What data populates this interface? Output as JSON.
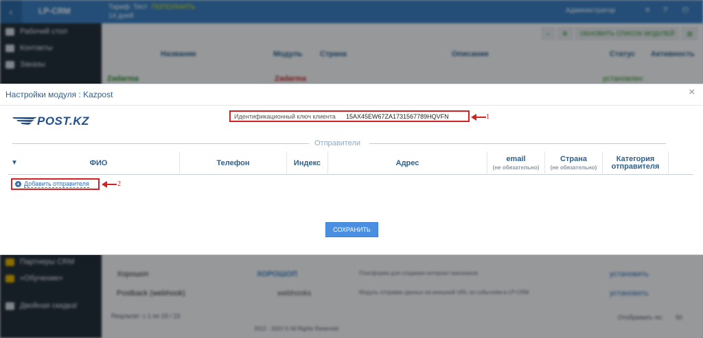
{
  "topbar": {
    "back_icon": "chevron-left",
    "logo": "LP-CRM",
    "tariff_line1": "Тариф: Тест",
    "tariff_badge": "ПОПОЛНИТЬ",
    "tariff_line2": "14 дней",
    "user": "Администратор"
  },
  "sidebar": {
    "items": [
      {
        "label": "Рабочий стол",
        "icon": "monitor-icon"
      },
      {
        "label": "Контакты",
        "icon": "users-icon"
      },
      {
        "label": "Заказы",
        "icon": "cart-icon"
      },
      {
        "label": "Партнеры CRM",
        "icon": "handshake-icon"
      },
      {
        "label": "«Обучение»",
        "icon": "video-icon"
      },
      {
        "label": "Двойная скидка!",
        "icon": "star-icon"
      }
    ]
  },
  "content": {
    "update_btn": "ОБНОВИТЬ СПИСОК МОДУЛЕЙ",
    "columns": [
      "Название",
      "Модуль",
      "Страна",
      "Описание",
      "Статус",
      "Активность"
    ],
    "status_filter": "Все",
    "rows": [
      {
        "name": "Zadarma",
        "module": "Zadarma",
        "status": "установлен"
      },
      {
        "name": "Хорошоп",
        "module": "ХОРОШОП",
        "desc": "Платформа для создания интернет-магазинов",
        "status": "установить"
      },
      {
        "name": "Postback (webhook)",
        "module": "webhooks",
        "desc": "Модуль отправки данных на внешний URL по событиям в LP-CRM",
        "status": "установить"
      }
    ],
    "footer_left": "Результат: с 1 по 23 / 23",
    "footer_right_label": "Отображать по:",
    "footer_right_value": "50",
    "copyright": "2012 - 2022 © All Rights Reserved"
  },
  "modal": {
    "title": "Настройки модуля : Kazpost",
    "close": "×",
    "logo_text": "POST.KZ",
    "key_label": "Идентификационный ключ клиента",
    "key_value": "15AX45EW67ZA1731567789HQVFN",
    "section_label": "Отправители",
    "columns": [
      {
        "label": "ФИО"
      },
      {
        "label": "Телефон"
      },
      {
        "label": "Индекс"
      },
      {
        "label": "Адрес"
      },
      {
        "label": "email",
        "sub": "(не обязательно)"
      },
      {
        "label": "Страна",
        "sub": "(не обязательно)"
      },
      {
        "label": "Категория отправителя"
      }
    ],
    "add_label": "Добавить отправителя",
    "save_label": "СОХРАНИТЬ",
    "annotations": {
      "one": "1",
      "two": "2"
    },
    "colors": {
      "accent": "#4a90e2",
      "annotation": "#d42020",
      "heading": "#2d5f8d"
    }
  }
}
